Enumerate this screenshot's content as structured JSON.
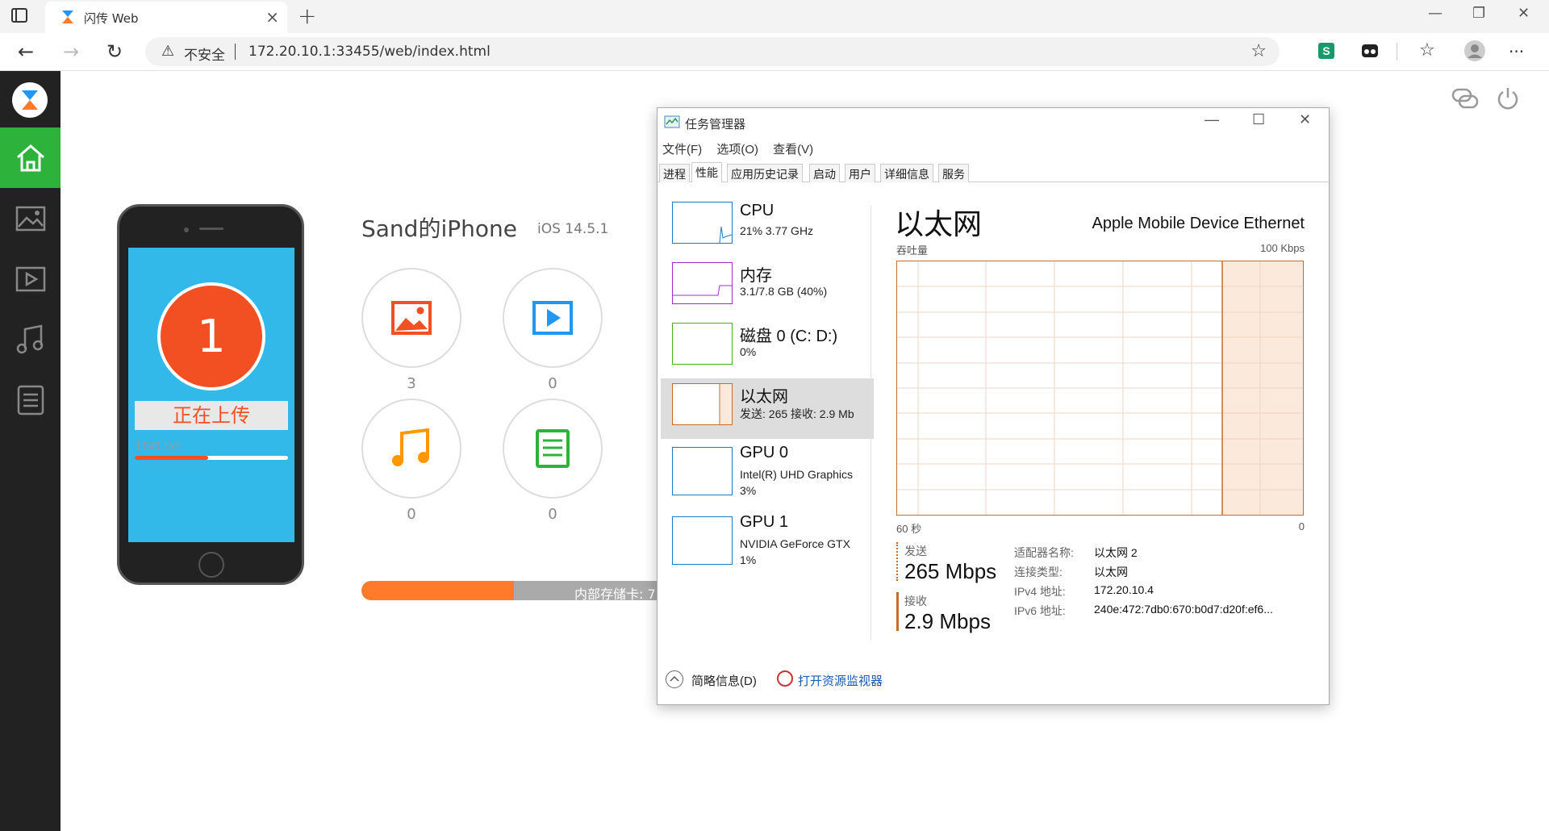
{
  "browser": {
    "tab_title": "闪传 Web",
    "tab_close": "×",
    "new_tab": "+",
    "win_min": "—",
    "win_restore": "❐",
    "win_close": "✕",
    "back": "←",
    "forward": "→",
    "reload": "↻",
    "security_label": "不安全",
    "url": "172.20.10.1:33455/web/index.html",
    "more": "···"
  },
  "device": {
    "name": "Sand的iPhone",
    "os": "iOS 14.5.1",
    "upload_count": "1",
    "upload_label": "正在上传",
    "file_name": "1GB.txt",
    "file_progress": 0.48
  },
  "categories": [
    {
      "name": "photos",
      "count": "3",
      "color": "#f25022"
    },
    {
      "name": "videos",
      "count": "0",
      "color": "#2196f3"
    },
    {
      "name": "music",
      "count": "0",
      "color": "#ff9800"
    },
    {
      "name": "documents",
      "count": "0",
      "color": "#2db33b"
    }
  ],
  "storage": {
    "label": "内部存储卡: 7",
    "used_fraction": 0.51
  },
  "taskmgr": {
    "title": "任务管理器",
    "menu": [
      "文件(F)",
      "选项(O)",
      "查看(V)"
    ],
    "tabs": [
      "进程",
      "性能",
      "应用历史记录",
      "启动",
      "用户",
      "详细信息",
      "服务"
    ],
    "active_tab": 1,
    "items": [
      {
        "name": "CPU",
        "sub1": "21% 3.77 GHz",
        "sub2": "",
        "color": "#1f7ac7"
      },
      {
        "name": "内存",
        "sub1": "3.1/7.8 GB (40%)",
        "sub2": "",
        "color": "#9b30c8"
      },
      {
        "name": "磁盘 0 (C: D:)",
        "sub1": "0%",
        "sub2": "",
        "color": "#4caf1a"
      },
      {
        "name": "以太网",
        "sub1": "发送: 265 接收: 2.9 Mb",
        "sub2": "",
        "color": "#c86c2a"
      },
      {
        "name": "GPU 0",
        "sub1": "Intel(R) UHD Graphics",
        "sub2": "3%",
        "color": "#1f7ac7"
      },
      {
        "name": "GPU 1",
        "sub1": "NVIDIA GeForce GTX",
        "sub2": "1%",
        "color": "#1f7ac7"
      }
    ],
    "detail": {
      "title": "以太网",
      "adapter": "Apple Mobile Device Ethernet",
      "throughput_label": "吞吐量",
      "scale": "100 Kbps",
      "time_left": "60 秒",
      "time_right": "0",
      "send_label": "发送",
      "send_value": "265 Mbps",
      "recv_label": "接收",
      "recv_value": "2.9 Mbps",
      "info": [
        {
          "label": "适配器名称:",
          "value": "以太网 2"
        },
        {
          "label": "连接类型:",
          "value": "以太网"
        },
        {
          "label": "IPv4 地址:",
          "value": "172.20.10.4"
        },
        {
          "label": "IPv6 地址:",
          "value": "240e:472:7db0:670:b0d7:d20f:ef6..."
        }
      ]
    },
    "footer_summary": "简略信息(D)",
    "footer_link": "打开资源监视器"
  }
}
